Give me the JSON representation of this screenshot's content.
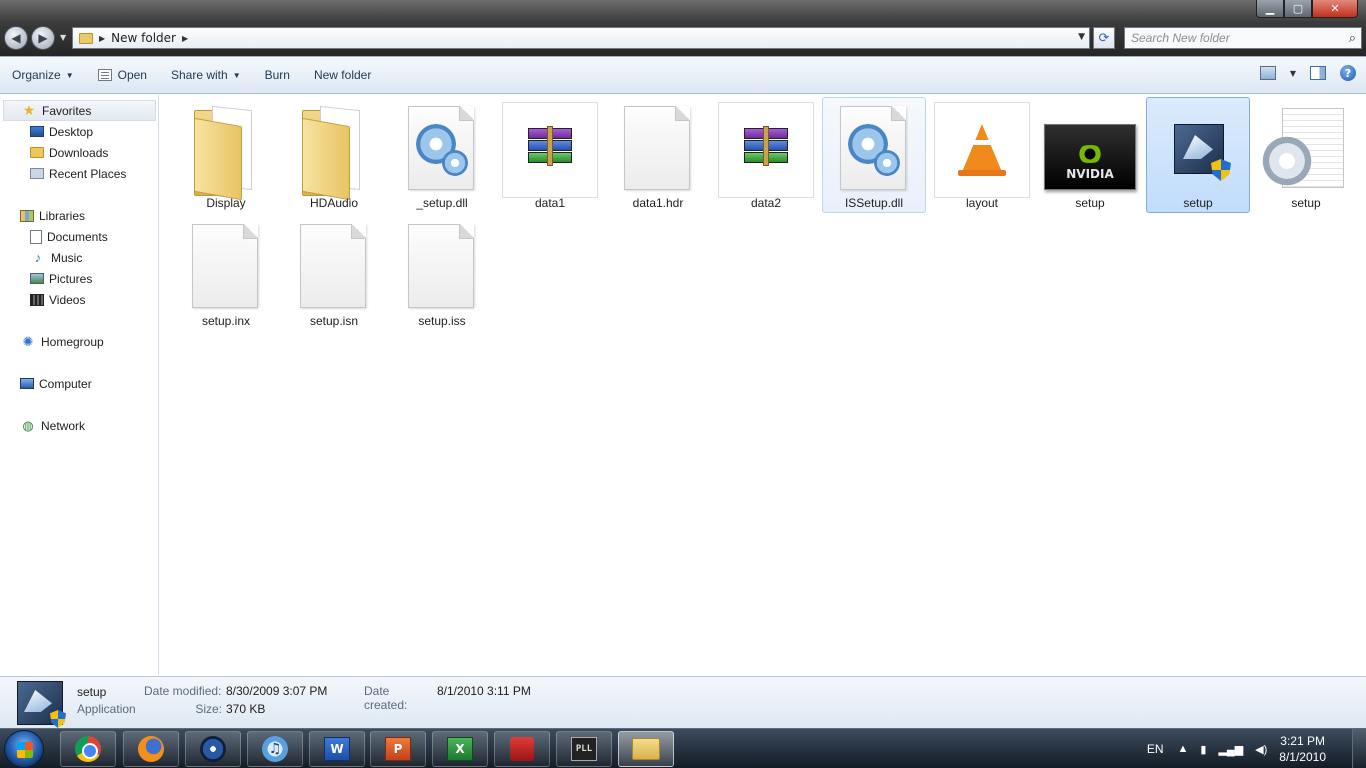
{
  "window": {
    "minimize_glyph": "▁",
    "maximize_glyph": "▢",
    "close_glyph": "✕"
  },
  "address": {
    "path": "New folder",
    "search_placeholder": "Search New folder"
  },
  "toolbar": {
    "organize": "Organize",
    "open": "Open",
    "share_with": "Share with",
    "burn": "Burn",
    "new_folder": "New folder"
  },
  "sidebar": {
    "favorites": "Favorites",
    "desktop": "Desktop",
    "downloads": "Downloads",
    "recent_places": "Recent Places",
    "libraries": "Libraries",
    "documents": "Documents",
    "music": "Music",
    "pictures": "Pictures",
    "videos": "Videos",
    "homegroup": "Homegroup",
    "computer": "Computer",
    "network": "Network"
  },
  "files": [
    {
      "name": "Display",
      "icon": "folder-icon"
    },
    {
      "name": "HDAudio",
      "icon": "folder-icon"
    },
    {
      "name": "_setup.dll",
      "icon": "dll-gear-icon"
    },
    {
      "name": "data1",
      "icon": "winrar-archive-icon"
    },
    {
      "name": "data1.hdr",
      "icon": "blank-file-icon"
    },
    {
      "name": "data2",
      "icon": "winrar-archive-icon"
    },
    {
      "name": "ISSetup.dll",
      "icon": "dll-gear-icon"
    },
    {
      "name": "layout",
      "icon": "vlc-cone-icon"
    },
    {
      "name": "setup",
      "icon": "nvidia-icon"
    },
    {
      "name": "setup",
      "icon": "setup-installer-icon"
    },
    {
      "name": "setup",
      "icon": "config-settings-icon"
    },
    {
      "name": "setup.inx",
      "icon": "blank-file-icon"
    },
    {
      "name": "setup.isn",
      "icon": "blank-file-icon"
    },
    {
      "name": "setup.iss",
      "icon": "blank-file-icon"
    }
  ],
  "details": {
    "name": "setup",
    "type": "Application",
    "date_modified_label": "Date modified:",
    "date_modified": "8/30/2009 3:07 PM",
    "date_created_label": "Date created:",
    "date_created": "8/1/2010 3:11 PM",
    "size_label": "Size:",
    "size": "370 KB"
  },
  "taskbar": {
    "apps": [
      "chrome-icon",
      "firefox-icon",
      "media-player-icon",
      "itunes-icon",
      "word-icon",
      "powerpoint-icon",
      "excel-icon",
      "red-app-icon",
      "pll-icon",
      "windows-explorer-icon"
    ],
    "word_letter": "W",
    "ppt_letter": "P",
    "excel_letter": "X",
    "pll_label": "PLL",
    "language": "EN",
    "time": "3:21 PM",
    "date": "8/1/2010"
  },
  "colors": {
    "selection_fill": "#c1dcfc",
    "selection_border": "#84acdd",
    "toolbar_text": "#1e3955"
  }
}
